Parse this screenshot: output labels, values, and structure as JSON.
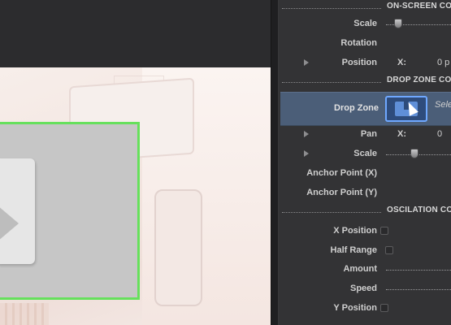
{
  "sections": {
    "onscreen": "ON-SCREEN CO",
    "dropzone": "DROP ZONE CO",
    "oscillation": "OSCILATION CO"
  },
  "rows": {
    "scale": "Scale",
    "rotation": "Rotation",
    "position": "Position",
    "position_axis": "X:",
    "position_value": "0 p",
    "drop_zone": "Drop Zone",
    "drop_zone_hint": "Sele",
    "pan": "Pan",
    "pan_axis": "X:",
    "pan_value": "0",
    "scale2": "Scale",
    "anchor_x": "Anchor Point (X)",
    "anchor_y": "Anchor Point (Y)",
    "x_position": "X Position",
    "half_range": "Half Range",
    "amount": "Amount",
    "speed": "Speed",
    "y_position": "Y Position"
  },
  "sliders": {
    "scale_level": 0.12,
    "scale2_level": 0.38
  }
}
